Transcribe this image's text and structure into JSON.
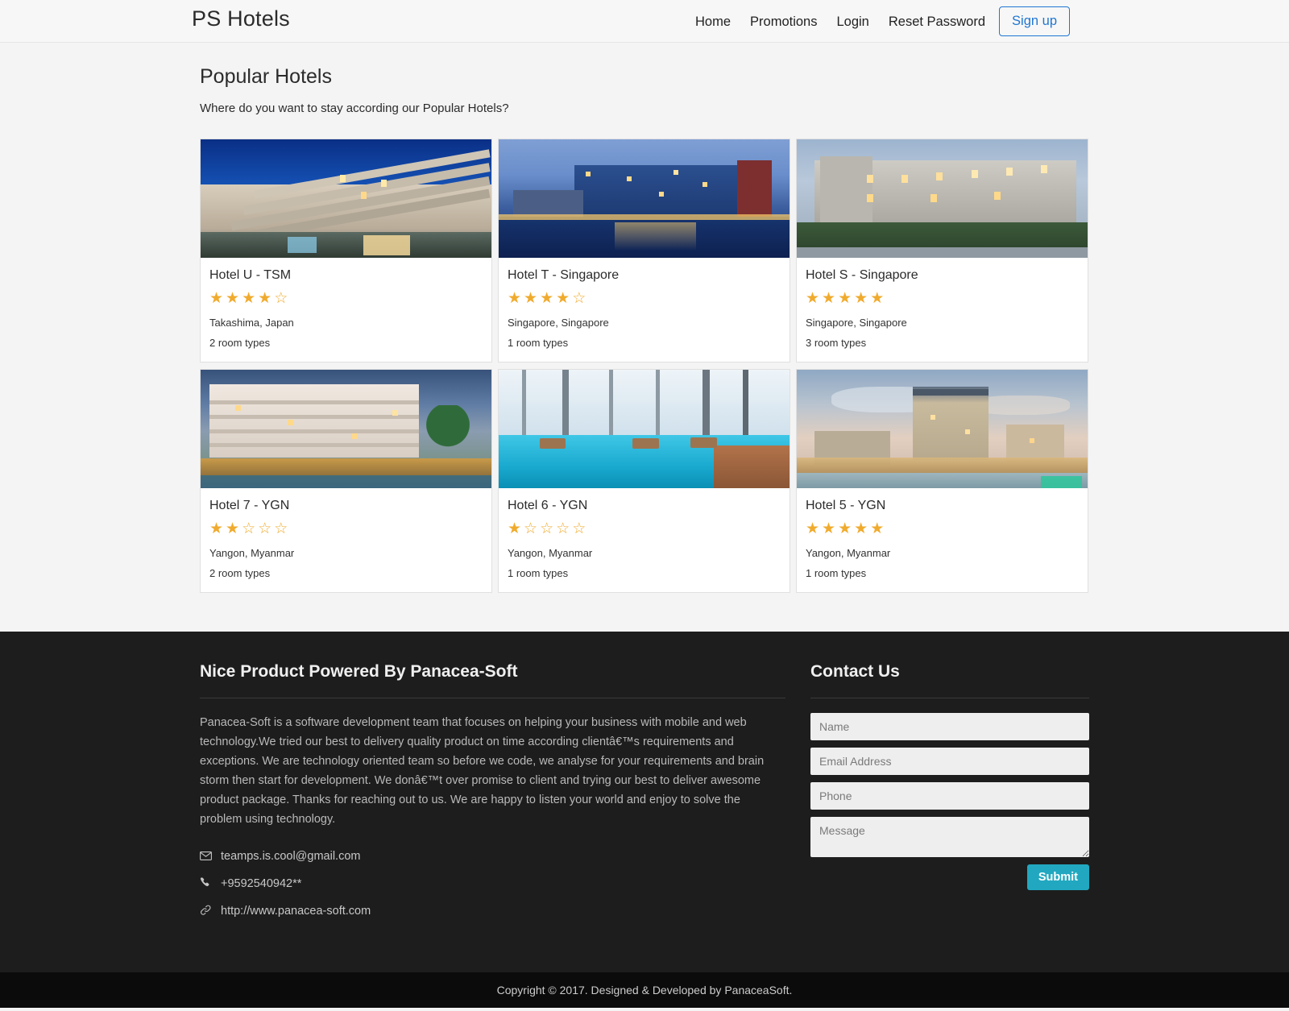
{
  "navbar": {
    "brand": "PS Hotels",
    "links": [
      {
        "label": "Home"
      },
      {
        "label": "Promotions"
      },
      {
        "label": "Login"
      },
      {
        "label": "Reset Password"
      }
    ],
    "signup_label": "Sign up",
    "accent_color": "#2076d2"
  },
  "main": {
    "title": "Popular Hotels",
    "subtitle": "Where do you want to stay according our Popular Hotels?",
    "star_color": "#f0ab2e",
    "hotels": [
      {
        "name": "Hotel U - TSM",
        "rating": 4,
        "max_rating": 5,
        "location": "Takashima, Japan",
        "rooms": "2 room types",
        "image": "hotel-exterior-night-blue-sky"
      },
      {
        "name": "Hotel T - Singapore",
        "rating": 4,
        "max_rating": 5,
        "location": "Singapore, Singapore",
        "rooms": "1 room types",
        "image": "waterfront-hotel-reflection-dusk"
      },
      {
        "name": "Hotel S - Singapore",
        "rating": 5,
        "max_rating": 5,
        "location": "Singapore, Singapore",
        "rooms": "3 room types",
        "image": "resort-hotel-lit-windows-evening"
      },
      {
        "name": "Hotel 7 - YGN",
        "rating": 2,
        "max_rating": 5,
        "location": "Yangon, Myanmar",
        "rooms": "2 room types",
        "image": "white-hotel-palm-trees"
      },
      {
        "name": "Hotel 6 - YGN",
        "rating": 1,
        "max_rating": 5,
        "location": "Yangon, Myanmar",
        "rooms": "1 room types",
        "image": "rooftop-infinity-pool"
      },
      {
        "name": "Hotel 5 - YGN",
        "rating": 5,
        "max_rating": 5,
        "location": "Yangon, Myanmar",
        "rooms": "1 room types",
        "image": "riverside-tower-hotel-sunset"
      }
    ],
    "star_filled_glyph": "★",
    "star_empty_glyph": "☆"
  },
  "footer": {
    "about": {
      "heading": "Nice Product Powered By Panacea-Soft",
      "body": "Panacea-Soft is a software development team that focuses on helping your business with mobile and web technology.We tried our best to delivery quality product on time according clientâ€™s requirements and exceptions. We are technology oriented team so before we code, we analyse for your requirements and brain storm then start for development. We donâ€™t over promise to client and trying our best to deliver awesome product package. Thanks for reaching out to us. We are happy to listen your world and enjoy to solve the problem using technology.",
      "contacts": [
        {
          "icon": "envelope-icon",
          "glyph": "✉",
          "value": "teamps.is.cool@gmail.com"
        },
        {
          "icon": "phone-icon",
          "glyph": "✆",
          "value": "+9592540942**"
        },
        {
          "icon": "link-icon",
          "glyph": "🔗",
          "value": "http://www.panacea-soft.com"
        }
      ]
    },
    "contact_form": {
      "heading": "Contact Us",
      "name_placeholder": "Name",
      "email_placeholder": "Email Address",
      "phone_placeholder": "Phone",
      "message_placeholder": "Message",
      "submit_label": "Submit",
      "submit_color": "#21a8c0"
    },
    "copyright": "Copyright © 2017. Designed & Developed by PanaceaSoft."
  }
}
